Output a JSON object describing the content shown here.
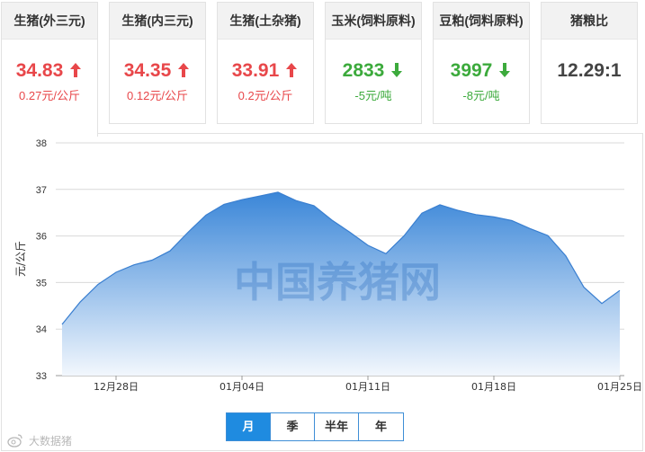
{
  "cards": [
    {
      "title": "生猪(外三元)",
      "value": "34.83",
      "change": "0.27元/公斤",
      "trend": "up",
      "active": true
    },
    {
      "title": "生猪(内三元)",
      "value": "34.35",
      "change": "0.12元/公斤",
      "trend": "up",
      "active": false
    },
    {
      "title": "生猪(土杂猪)",
      "value": "33.91",
      "change": "0.2元/公斤",
      "trend": "up",
      "active": false
    },
    {
      "title": "玉米(饲料原料)",
      "value": "2833",
      "change": "-5元/吨",
      "trend": "down",
      "active": false
    },
    {
      "title": "豆粕(饲料原料)",
      "value": "3997",
      "change": "-8元/吨",
      "trend": "down",
      "active": false
    },
    {
      "title": "猪粮比",
      "value": "12.29:1",
      "change": "",
      "trend": "flat",
      "active": false
    }
  ],
  "colors": {
    "up": "#e8474a",
    "down": "#3caa3c",
    "area_top": "#3a86d8",
    "area_bottom": "#f2f7fd",
    "line": "#3a7fd0",
    "tab_selected": "#1f8be0"
  },
  "chart_data": {
    "type": "area",
    "ylabel": "元/公斤",
    "ylim": [
      33,
      38
    ],
    "yticks": [
      33,
      34,
      35,
      36,
      37,
      38
    ],
    "x": [
      "12-25",
      "12-26",
      "12-27",
      "12-28",
      "12-29",
      "12-30",
      "12-31",
      "01-01",
      "01-02",
      "01-03",
      "01-04",
      "01-05",
      "01-06",
      "01-07",
      "01-08",
      "01-09",
      "01-10",
      "01-11",
      "01-12",
      "01-13",
      "01-14",
      "01-15",
      "01-16",
      "01-17",
      "01-18",
      "01-19",
      "01-20",
      "01-21",
      "01-22",
      "01-23",
      "01-24",
      "01-25"
    ],
    "xtick_labels": [
      {
        "index": 3,
        "label": "12月28日"
      },
      {
        "index": 10,
        "label": "01月04日"
      },
      {
        "index": 17,
        "label": "01月11日"
      },
      {
        "index": 24,
        "label": "01月18日"
      },
      {
        "index": 31,
        "label": "01月25日"
      }
    ],
    "values": [
      34.1,
      34.58,
      34.96,
      35.22,
      35.38,
      35.48,
      35.68,
      36.08,
      36.45,
      36.68,
      36.78,
      36.86,
      36.94,
      36.76,
      36.65,
      36.34,
      36.08,
      35.8,
      35.62,
      36.0,
      36.49,
      36.67,
      36.55,
      36.46,
      36.41,
      36.33,
      36.16,
      36.01,
      35.57,
      34.9,
      34.55,
      34.83
    ],
    "grid": true,
    "legend": "none"
  },
  "watermark": {
    "center_text": "中国养猪网",
    "logo_text": "大数据猪"
  },
  "range_tabs": [
    {
      "label": "月",
      "selected": true
    },
    {
      "label": "季",
      "selected": false
    },
    {
      "label": "半年",
      "selected": false
    },
    {
      "label": "年",
      "selected": false
    }
  ]
}
